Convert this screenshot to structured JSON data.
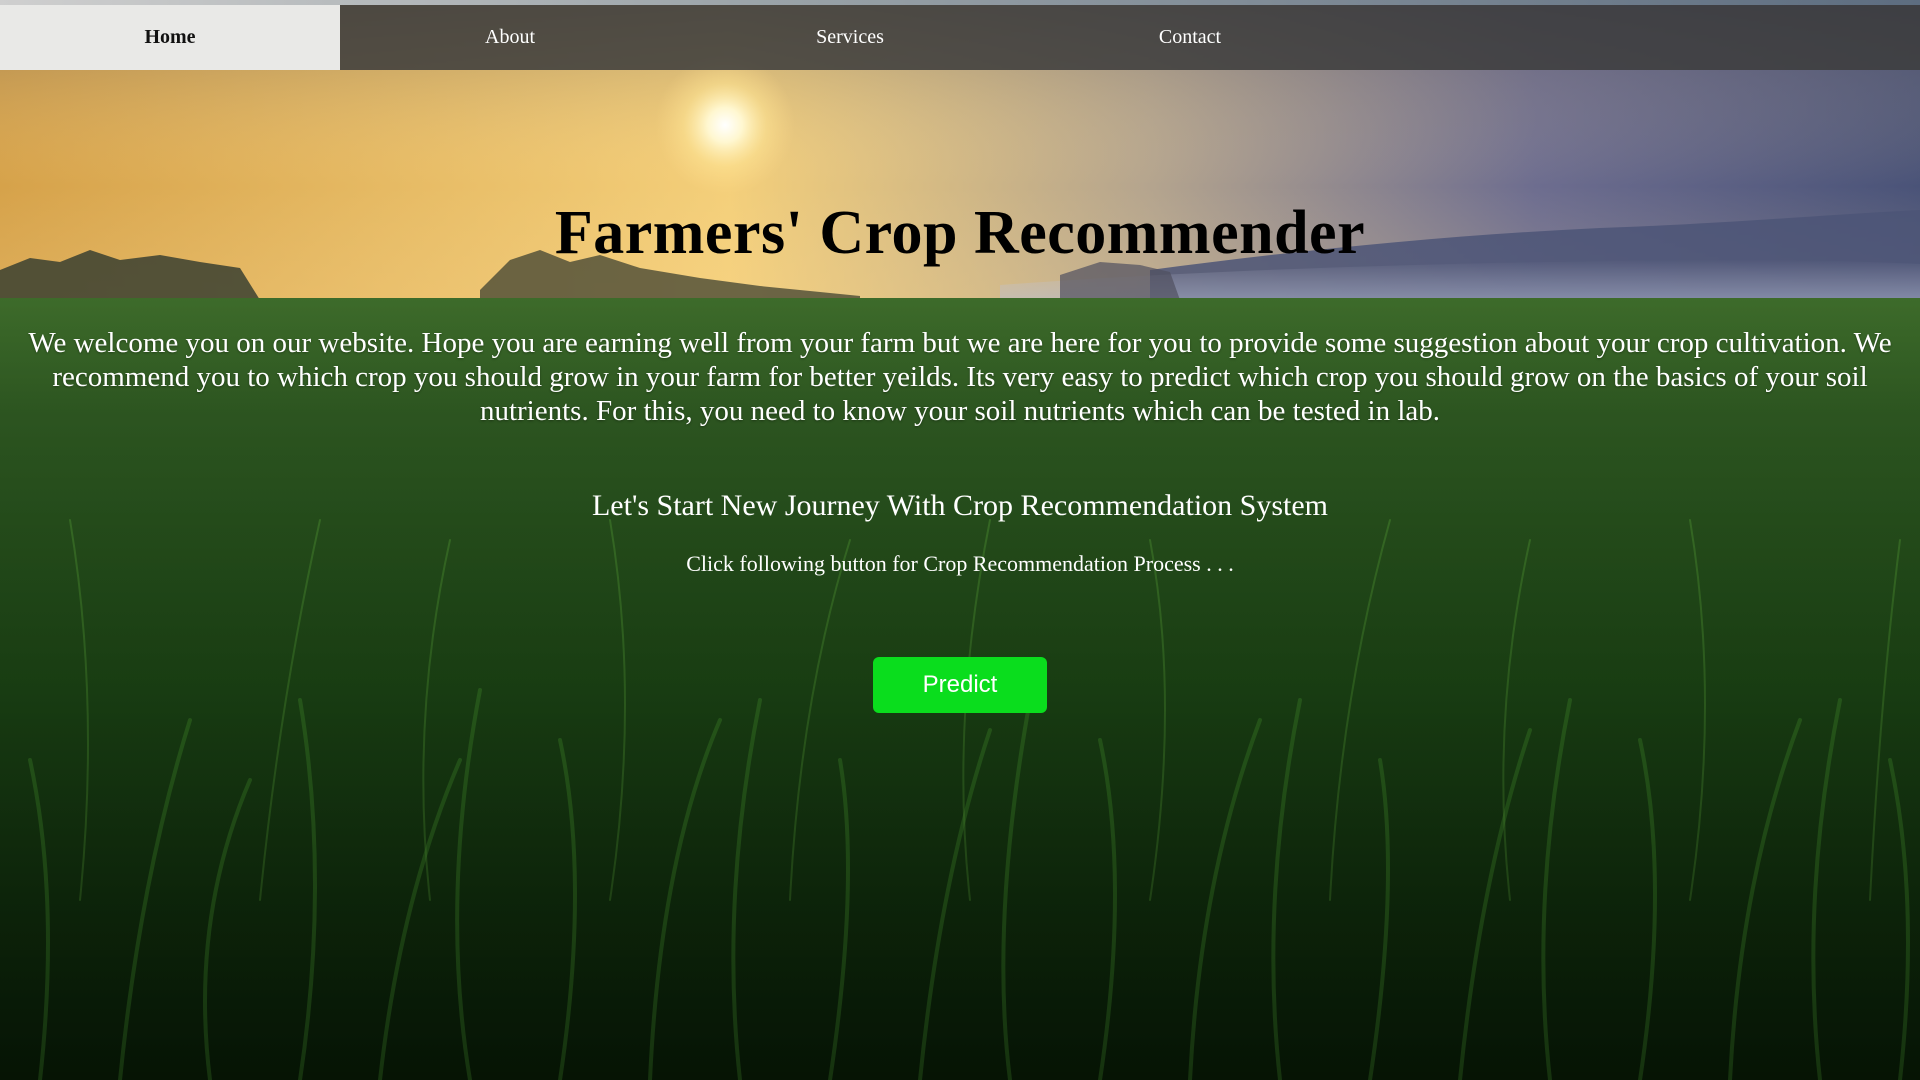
{
  "nav": {
    "items": [
      {
        "label": "Home",
        "active": true
      },
      {
        "label": "About",
        "active": false
      },
      {
        "label": "Services",
        "active": false
      },
      {
        "label": "Contact",
        "active": false
      }
    ]
  },
  "hero": {
    "title": "Farmers' Crop Recommender",
    "welcome_text": "We welcome you on our website. Hope you are earning well from your farm but we are here for you to provide some suggestion about your crop cultivation. We recommend you to which crop you should grow in your farm for better yeilds. Its very easy to predict which crop you should grow on the basics of your soil nutrients. For this, you need to know your soil nutrients which can be tested in lab.",
    "journey_heading": "Let's Start New Journey With Crop Recommendation System",
    "click_text": "Click following button for Crop Recommendation Process . . .",
    "predict_button": "Predict"
  },
  "colors": {
    "nav_bg": "#3c3c3c",
    "nav_active_bg": "#e9e9e7",
    "button_green": "#0add1d",
    "title_color": "#000000",
    "text_color": "#ffffff"
  },
  "background": {
    "description_icon": "grass-field-sunrise-image"
  }
}
